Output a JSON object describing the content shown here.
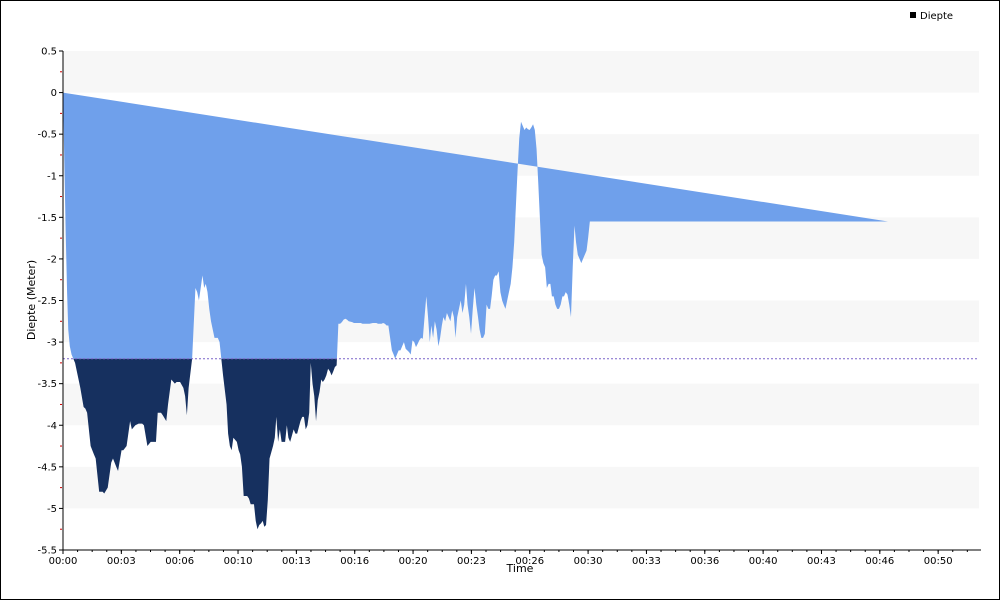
{
  "chart_data": {
    "type": "area",
    "xlabel": "Time",
    "ylabel": "Diepte (Meter)",
    "ylim": [
      -5.5,
      0.5
    ],
    "y_ticks": [
      "0.5",
      "0",
      "-0.5",
      "-1",
      "-1.5",
      "-2",
      "-2.5",
      "-3",
      "-3.5",
      "-4",
      "-4.5",
      "-5",
      "-5.5"
    ],
    "x_tick_labels": [
      "00:00",
      "00:03",
      "00:06",
      "00:10",
      "00:13",
      "00:16",
      "00:20",
      "00:23",
      "00:26",
      "00:30",
      "00:33",
      "00:36",
      "00:40",
      "00:43",
      "00:46",
      "00:50"
    ],
    "x_tick_positions_min": [
      0,
      3,
      6,
      9,
      12,
      15,
      18,
      21,
      24,
      27,
      30,
      33,
      36,
      39,
      42,
      45
    ],
    "x_max_min": 47.1,
    "threshold": -3.2,
    "legend": {
      "position": "top-right",
      "label": "Diepte"
    },
    "colors": {
      "fill_shallow": "#6fa0eb",
      "fill_deep": "#16305f",
      "threshold_line": "#7a63c9",
      "band": "#f7f7f7",
      "axis": "#000000",
      "minor_tick": "#cc0000",
      "legend_marker": "#000000"
    },
    "series": [
      {
        "name": "Diepte",
        "x_min": [
          0.0,
          0.14,
          0.21,
          0.27,
          0.35,
          0.44,
          0.53,
          0.62,
          0.71,
          0.89,
          1.06,
          1.15,
          1.24,
          1.42,
          1.59,
          1.68,
          1.86,
          2.04,
          2.12,
          2.3,
          2.48,
          2.57,
          2.74,
          2.83,
          3.01,
          3.1,
          3.27,
          3.45,
          3.54,
          3.72,
          3.89,
          3.98,
          4.07,
          4.16,
          4.34,
          4.51,
          4.6,
          4.78,
          4.87,
          5.04,
          5.13,
          5.31,
          5.4,
          5.57,
          5.75,
          5.84,
          6.02,
          6.19,
          6.28,
          6.37,
          6.46,
          6.64,
          6.81,
          6.9,
          6.99,
          7.08,
          7.17,
          7.26,
          7.34,
          7.43,
          7.52,
          7.61,
          7.7,
          7.79,
          7.96,
          8.05,
          8.14,
          8.23,
          8.41,
          8.49,
          8.58,
          8.67,
          8.76,
          8.94,
          9.03,
          9.11,
          9.2,
          9.29,
          9.47,
          9.56,
          9.65,
          9.73,
          9.82,
          9.91,
          10.0,
          10.09,
          10.18,
          10.27,
          10.35,
          10.44,
          10.53,
          10.62,
          10.8,
          10.89,
          10.97,
          11.06,
          11.15,
          11.24,
          11.42,
          11.51,
          11.59,
          11.68,
          11.86,
          11.95,
          12.04,
          12.21,
          12.3,
          12.39,
          12.48,
          12.57,
          12.66,
          12.74,
          12.83,
          12.92,
          13.01,
          13.1,
          13.19,
          13.28,
          13.36,
          13.45,
          13.54,
          13.63,
          13.72,
          13.81,
          13.9,
          13.98,
          14.07,
          14.16,
          14.25,
          14.34,
          14.43,
          14.52,
          14.6,
          14.69,
          14.87,
          14.96,
          15.05,
          15.14,
          15.22,
          15.31,
          15.4,
          15.49,
          15.58,
          15.67,
          15.76,
          15.93,
          16.02,
          16.11,
          16.2,
          16.29,
          16.38,
          16.46,
          16.55,
          16.64,
          16.73,
          16.82,
          16.91,
          17.0,
          17.08,
          17.17,
          17.26,
          17.35,
          17.44,
          17.53,
          17.62,
          17.79,
          17.88,
          17.97,
          18.06,
          18.15,
          18.24,
          18.32,
          18.41,
          18.5,
          18.59,
          18.68,
          18.77,
          18.86,
          18.94,
          19.03,
          19.12,
          19.21,
          19.3,
          19.39,
          19.48,
          19.56,
          19.65,
          19.74,
          19.83,
          19.92,
          20.01,
          20.1,
          20.18,
          20.27,
          20.36,
          20.45,
          20.54,
          20.63,
          20.72,
          20.8,
          20.89,
          20.98,
          21.07,
          21.16,
          21.25,
          21.34,
          21.42,
          21.51,
          21.6,
          21.69,
          21.78,
          21.87,
          21.96,
          22.04,
          22.13,
          22.22,
          22.31,
          22.4,
          22.49,
          22.58,
          22.66,
          22.75,
          22.84,
          22.93,
          23.02,
          23.11,
          23.2,
          23.28,
          23.37,
          23.46,
          23.55,
          23.64,
          23.73,
          23.82,
          23.9,
          23.99,
          24.08,
          24.17,
          24.26,
          24.35,
          24.44,
          24.52,
          24.61,
          24.7,
          24.79,
          24.88,
          24.97,
          25.06,
          25.14,
          25.23,
          25.32,
          25.41,
          25.5,
          25.59,
          25.68,
          25.76,
          25.85,
          25.94,
          26.03,
          26.12,
          26.21,
          26.3,
          26.38,
          26.47,
          26.56,
          26.65,
          26.74,
          26.83,
          26.92,
          27.0,
          27.09,
          27.18,
          27.27,
          27.36,
          27.45,
          27.54,
          27.62,
          27.71,
          27.8,
          27.89,
          27.98,
          28.07,
          28.16,
          28.24,
          28.33,
          28.42,
          28.51,
          28.6,
          28.69,
          28.78,
          28.86,
          28.95,
          29.04,
          29.13,
          29.22,
          29.31,
          29.4,
          29.48,
          29.57,
          29.66,
          29.75,
          29.84,
          29.93,
          30.02,
          30.1,
          30.19,
          30.28,
          30.37,
          30.46,
          30.55,
          30.64,
          30.72,
          30.81,
          30.9,
          30.99,
          31.08,
          31.17,
          31.26,
          31.34,
          31.43,
          31.52,
          31.61,
          31.7,
          31.79,
          31.88,
          31.96,
          32.05,
          32.14,
          32.23,
          32.32,
          32.41,
          32.5,
          32.58,
          32.67,
          32.76,
          32.85,
          32.94,
          33.03,
          33.12,
          33.2,
          33.29,
          33.38,
          33.47,
          33.56,
          33.65,
          33.74,
          33.82,
          33.91,
          34.0,
          34.09,
          34.18,
          34.27,
          34.36,
          34.44,
          34.53,
          34.62,
          34.71,
          34.8,
          34.89,
          34.98,
          35.06,
          35.15,
          35.24,
          35.33,
          35.42,
          35.51,
          35.6,
          35.68,
          35.77,
          35.86,
          35.95,
          36.04,
          36.13,
          36.22,
          36.3,
          36.39,
          36.48,
          36.57,
          36.66,
          36.75,
          36.84,
          36.92,
          37.01,
          37.1,
          37.19,
          37.28,
          37.37,
          37.46,
          37.54,
          37.63,
          37.72,
          37.81,
          37.9,
          37.99,
          38.08,
          38.16,
          38.25,
          38.34,
          38.43,
          38.52,
          38.61,
          38.7,
          38.78,
          38.87,
          38.96,
          39.05,
          39.14,
          39.23,
          39.32,
          39.4,
          39.49,
          39.58,
          39.67,
          39.76,
          39.85,
          39.94,
          40.02,
          40.11,
          40.2,
          40.29,
          40.38,
          40.47,
          40.56,
          40.64,
          40.73,
          40.82,
          40.91,
          41.0,
          41.09,
          41.18,
          41.26,
          41.35,
          41.44,
          41.53,
          41.62,
          41.71,
          41.8,
          41.88,
          41.97,
          42.06,
          42.15,
          42.24,
          42.33,
          42.42,
          42.5,
          42.59,
          42.68,
          42.77,
          42.86,
          42.95,
          43.04,
          43.12,
          43.21,
          43.3,
          43.39,
          43.48,
          43.57,
          43.66,
          43.74,
          43.83,
          43.92,
          44.01,
          44.1,
          44.19,
          44.28,
          44.36,
          44.45,
          44.54,
          44.63,
          44.72,
          44.81,
          44.9,
          44.98,
          45.07,
          45.16,
          45.25,
          45.34,
          45.43,
          45.52,
          45.6,
          45.69,
          45.78,
          45.87,
          45.96,
          46.05,
          46.14,
          46.22,
          46.31,
          46.4,
          46.49,
          46.58,
          46.67,
          46.76,
          46.84,
          46.93,
          47.02,
          47.11
        ],
        "y": [
          0.0,
          -1.7,
          -2.4,
          -2.85,
          -3.05,
          -3.15,
          -3.2,
          -3.25,
          -3.35,
          -3.55,
          -3.78,
          -3.8,
          -3.85,
          -4.25,
          -4.35,
          -4.4,
          -4.8,
          -4.8,
          -4.82,
          -4.75,
          -4.45,
          -4.4,
          -4.5,
          -4.55,
          -4.3,
          -4.3,
          -4.25,
          -3.95,
          -4.05,
          -4.0,
          -3.98,
          -3.98,
          -3.98,
          -4.0,
          -4.25,
          -4.2,
          -4.2,
          -4.2,
          -3.85,
          -3.85,
          -3.88,
          -3.95,
          -3.75,
          -3.45,
          -3.5,
          -3.48,
          -3.48,
          -3.55,
          -3.65,
          -3.88,
          -3.55,
          -3.2,
          -2.35,
          -2.4,
          -2.5,
          -2.35,
          -2.2,
          -2.35,
          -2.3,
          -2.4,
          -2.6,
          -2.75,
          -2.85,
          -2.95,
          -2.95,
          -3.0,
          -3.2,
          -3.4,
          -3.75,
          -4.1,
          -4.25,
          -4.3,
          -4.15,
          -4.2,
          -4.3,
          -4.35,
          -4.5,
          -4.85,
          -4.85,
          -4.88,
          -4.95,
          -4.95,
          -4.95,
          -5.15,
          -5.25,
          -5.2,
          -5.18,
          -5.15,
          -5.22,
          -5.2,
          -4.9,
          -4.4,
          -4.25,
          -4.15,
          -3.9,
          -4.2,
          -4.05,
          -4.2,
          -4.2,
          -4.0,
          -4.15,
          -4.2,
          -4.05,
          -4.1,
          -4.1,
          -3.95,
          -3.9,
          -3.9,
          -4.05,
          -4.0,
          -3.85,
          -3.25,
          -3.5,
          -3.65,
          -3.95,
          -3.7,
          -3.6,
          -3.45,
          -3.48,
          -3.45,
          -3.4,
          -3.32,
          -3.35,
          -3.4,
          -3.35,
          -3.3,
          -3.28,
          -2.78,
          -2.78,
          -2.76,
          -2.73,
          -2.72,
          -2.73,
          -2.75,
          -2.76,
          -2.77,
          -2.77,
          -2.77,
          -2.77,
          -2.77,
          -2.78,
          -2.78,
          -2.78,
          -2.78,
          -2.78,
          -2.77,
          -2.77,
          -2.77,
          -2.78,
          -2.78,
          -2.78,
          -2.77,
          -2.78,
          -2.8,
          -2.8,
          -2.95,
          -3.1,
          -3.15,
          -3.2,
          -3.15,
          -3.1,
          -3.1,
          -3.05,
          -3.0,
          -3.08,
          -3.12,
          -3.15,
          -2.98,
          -3.0,
          -3.06,
          -3.02,
          -2.98,
          -2.95,
          -2.96,
          -2.7,
          -2.45,
          -2.7,
          -3.0,
          -2.8,
          -2.95,
          -2.75,
          -2.85,
          -3.05,
          -2.95,
          -2.8,
          -2.7,
          -2.75,
          -2.65,
          -2.7,
          -2.75,
          -2.62,
          -2.7,
          -2.95,
          -2.7,
          -2.6,
          -2.5,
          -2.65,
          -2.55,
          -2.3,
          -2.55,
          -2.7,
          -2.9,
          -2.6,
          -2.35,
          -2.55,
          -2.7,
          -2.85,
          -2.95,
          -2.95,
          -2.9,
          -2.55,
          -2.6,
          -2.6,
          -2.45,
          -2.25,
          -2.2,
          -2.2,
          -2.15,
          -2.4,
          -2.5,
          -2.55,
          -2.6,
          -2.5,
          -2.4,
          -2.3,
          -2.1,
          -1.8,
          -1.4,
          -0.95,
          -0.55,
          -0.35,
          -0.4,
          -0.45,
          -0.42,
          -0.44,
          -0.45,
          -0.42,
          -0.38,
          -0.45,
          -0.68,
          -1.1,
          -1.5,
          -1.95,
          -2.05,
          -2.1,
          -2.35,
          -2.3,
          -2.3,
          -2.45,
          -2.45,
          -2.55,
          -2.6,
          -2.6,
          -2.55,
          -2.45,
          -2.45,
          -2.4,
          -2.43,
          -2.55,
          -2.7,
          -2.1,
          -1.6,
          -1.8,
          -1.95,
          -2.0,
          -2.05,
          -2.0,
          -1.95,
          -1.9,
          -1.75,
          -1.55,
          -1.55,
          -1.55,
          -1.55,
          -1.55,
          -1.55,
          -1.55,
          -1.55,
          -1.55,
          -1.55,
          -1.55,
          -1.55,
          -1.55,
          -1.55,
          -1.55,
          -1.55,
          -1.55,
          -1.55,
          -1.55,
          -1.55,
          -1.55,
          -1.55,
          -1.55,
          -1.55,
          -1.55,
          -1.55,
          -1.55,
          -1.55,
          -1.55,
          -1.55,
          -1.55,
          -1.55,
          -1.55,
          -1.55,
          -1.55,
          -1.55,
          -1.55,
          -1.55,
          -1.55,
          -1.55,
          -1.55,
          -1.55,
          -1.55,
          -1.55,
          -1.55,
          -1.55,
          -1.55,
          -1.55,
          -1.55,
          -1.55,
          -1.55,
          -1.55,
          -1.55,
          -1.55,
          -1.55,
          -1.55,
          -1.55,
          -1.55,
          -1.55,
          -1.55,
          -1.55,
          -1.55,
          -1.55,
          -1.55,
          -1.55,
          -1.55,
          -1.55,
          -1.55,
          -1.55,
          -1.55,
          -1.55,
          -1.55,
          -1.55,
          -1.55,
          -1.55,
          -1.55,
          -1.55,
          -1.55,
          -1.55,
          -1.55,
          -1.55,
          -1.55,
          -1.55,
          -1.55,
          -1.55,
          -1.55,
          -1.55,
          -1.55,
          -1.55,
          -1.55,
          -1.55,
          -1.55,
          -1.55,
          -1.55,
          -1.55,
          -1.55,
          -1.55,
          -1.55,
          -1.55,
          -1.55,
          -1.55,
          -1.55,
          -1.55,
          -1.55,
          -1.55,
          -1.55,
          -1.55,
          -1.55,
          -1.55,
          -1.55,
          -1.55,
          -1.55,
          -1.55,
          -1.55,
          -1.55,
          -1.55,
          -1.55,
          -1.55,
          -1.55,
          -1.55,
          -1.55,
          -1.55,
          -1.55,
          -1.55,
          -1.55,
          -1.55,
          -1.55,
          -1.55,
          -1.55,
          -1.55,
          -1.55,
          -1.55,
          -1.55,
          -1.55,
          -1.55,
          -1.55,
          -1.55,
          -1.55,
          -1.55,
          -1.55,
          -1.55,
          -1.55,
          -1.55,
          -1.55,
          -1.55,
          -1.55,
          -1.55,
          -1.55,
          -1.55,
          -1.55,
          -1.55,
          -1.55,
          -1.55,
          -1.55,
          -1.55,
          -1.55,
          -1.55,
          -1.55,
          -1.55,
          -1.55,
          -1.55,
          -1.55,
          -1.55,
          -1.55,
          -1.55,
          -1.55,
          -1.55,
          -1.55,
          -1.55,
          -1.55,
          -1.55,
          -1.55,
          -1.55,
          -1.55
        ]
      }
    ]
  }
}
